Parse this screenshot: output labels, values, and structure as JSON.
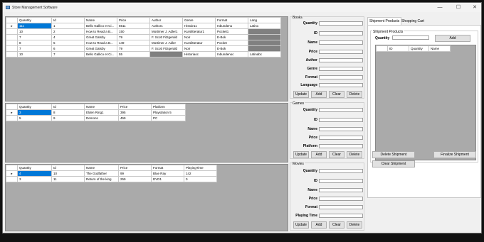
{
  "window": {
    "title": "Store Management Software",
    "controls": [
      "—",
      "☐",
      "✕"
    ]
  },
  "books_grid": {
    "columns": [
      "Quantity",
      "Id",
      "Name",
      "Price",
      "Author",
      "Genre",
      "Format",
      "Lang"
    ],
    "rows": [
      [
        "111",
        "1",
        "Bello Gallico et Ci...",
        "5511",
        "Author1",
        "Histoira1",
        "Inbunden1",
        "Latin1"
      ],
      [
        "10",
        "2",
        "How to Read a B...",
        "150",
        "Mortimer J. Adler1",
        "Kurslitteratur1",
        "Pocket1",
        ""
      ],
      [
        "7",
        "4",
        "Great Gatsby",
        "79",
        "F. Scott Fitzgerald",
        "Noir",
        "E-Bok",
        ""
      ],
      [
        "8",
        "5",
        "How to Read a B...",
        "149",
        "Mortimer J. Adler",
        "Kurslitteratur",
        "Pocket",
        ""
      ],
      [
        "7",
        "6",
        "Great Gatsby",
        "79",
        "F. Scott Fitzgerald",
        "Noir",
        "E-Bok",
        ""
      ],
      [
        "10",
        "7",
        "Bello Gallico et Ci...",
        "55",
        "",
        "Historiaoc",
        "Inbundenoc",
        "Latinabc"
      ]
    ]
  },
  "games_grid": {
    "columns": [
      "Quantity",
      "Id",
      "Name",
      "Price",
      "Platform"
    ],
    "rows": [
      [
        "3",
        "8",
        "Elden Ring1",
        "395",
        "Playstation 5"
      ],
      [
        "5",
        "9",
        "Demons",
        "459",
        "PC"
      ]
    ]
  },
  "movies_grid": {
    "columns": [
      "Quantity",
      "Id",
      "Name",
      "Price",
      "Format",
      "PlayingTime"
    ],
    "rows": [
      [
        "4",
        "10",
        "The Godfather",
        "99",
        "Blue Ray",
        "142"
      ],
      [
        "3",
        "11",
        "Return of the king",
        "259",
        "DVD1",
        "0"
      ]
    ]
  },
  "books_form": {
    "title": "Books",
    "labels": [
      "Quantity",
      "ID",
      "Name",
      "Price",
      "Author",
      "Genre",
      "Format",
      "Language"
    ],
    "buttons": [
      "Update",
      "Add",
      "Clear",
      "Delete"
    ]
  },
  "games_form": {
    "title": "Games",
    "labels": [
      "Quantity",
      "ID",
      "Name",
      "Price",
      "Platform"
    ],
    "buttons": [
      "Update",
      "Add",
      "Clear",
      "Delete"
    ]
  },
  "movies_form": {
    "title": "Movies",
    "labels": [
      "Quantity",
      "ID",
      "Name",
      "Price",
      "Format",
      "Playing Time"
    ],
    "buttons": [
      "Update",
      "Add",
      "Clear",
      "Delete"
    ]
  },
  "right_panel": {
    "tabs": [
      "Shipment Products",
      "Shopping Cart"
    ],
    "group_title": "Shipment Products",
    "quantity_label": "Quantity",
    "add_label": "Add",
    "columns": [
      "ID",
      "Quantity",
      "Name"
    ],
    "delete_label": "Delete Shipment",
    "finalize_label": "Finalize Shipment",
    "clear_label": "Clear Shipment"
  },
  "colors": {
    "selection": "#0078d7",
    "grid_bg": "#aaaaaa",
    "empty_cell": "#808080"
  }
}
